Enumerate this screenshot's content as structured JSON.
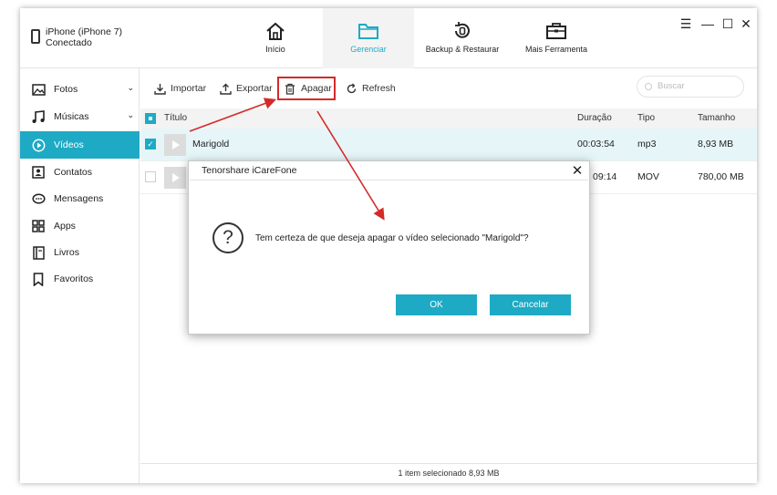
{
  "device": {
    "name": "iPhone (iPhone 7)",
    "status": "Conectado"
  },
  "nav": {
    "tabs": [
      {
        "label": "Início",
        "icon": "home-icon"
      },
      {
        "label": "Gerenciar",
        "icon": "folder-icon",
        "active": true
      },
      {
        "label": "Backup & Restaurar",
        "icon": "backup-restore-icon"
      },
      {
        "label": "Mais Ferramenta",
        "icon": "toolbox-icon"
      }
    ]
  },
  "window_controls": {
    "menu": "☰",
    "minimize": "—",
    "maximize": "☐",
    "close": "✕"
  },
  "sidebar": {
    "items": [
      {
        "label": "Fotos",
        "icon": "photo-icon",
        "chevron": "⌄"
      },
      {
        "label": "Músicas",
        "icon": "music-icon",
        "chevron": "⌄"
      },
      {
        "label": "Vídeos",
        "icon": "video-icon",
        "active": true
      },
      {
        "label": "Contatos",
        "icon": "contacts-icon"
      },
      {
        "label": "Mensagens",
        "icon": "messages-icon"
      },
      {
        "label": "Apps",
        "icon": "apps-icon"
      },
      {
        "label": "Livros",
        "icon": "books-icon"
      },
      {
        "label": "Favoritos",
        "icon": "bookmark-icon"
      }
    ]
  },
  "toolbar": {
    "import_label": "Importar",
    "export_label": "Exportar",
    "delete_label": "Apagar",
    "refresh_label": "Refresh",
    "search_placeholder": "Buscar"
  },
  "table": {
    "headers": {
      "title": "Título",
      "duration": "Duração",
      "type": "Tipo",
      "size": "Tamanho"
    },
    "rows": [
      {
        "title": "Marigold",
        "duration": "00:03:54",
        "type": "mp3",
        "size": "8,93 MB",
        "checked": true
      },
      {
        "title": "",
        "duration": "09:14",
        "type": "MOV",
        "size": "780,00 MB",
        "checked": false
      }
    ]
  },
  "status": {
    "text": "1 item selecionado 8,93 MB"
  },
  "dialog": {
    "title": "Tenorshare iCareFone",
    "close": "✕",
    "icon": "question-icon",
    "message": "Tem certeza de que deseja apagar o vídeo selecionado \"Marigold\"?",
    "ok_label": "OK",
    "cancel_label": "Cancelar"
  },
  "colors": {
    "accent": "#1eaac4",
    "annotation": "#d42a2a"
  }
}
